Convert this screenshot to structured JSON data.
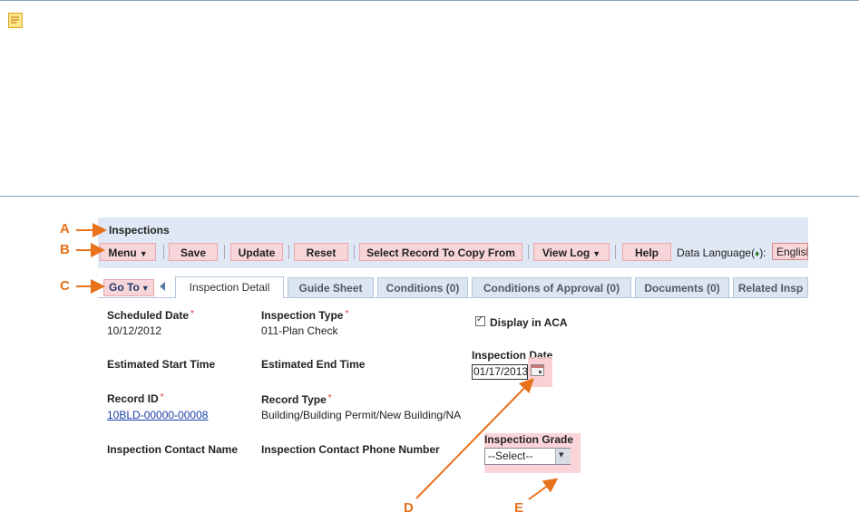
{
  "header": {
    "title": "Inspections"
  },
  "toolbar": {
    "menu_label": "Menu",
    "save_label": "Save",
    "update_label": "Update",
    "reset_label": "Reset",
    "copy_label": "Select Record To Copy From",
    "viewlog_label": "View Log",
    "help_label": "Help",
    "data_language_label": "Data Language(",
    "data_language_suffix": "):",
    "data_language_value": "English"
  },
  "goto": {
    "label": "Go To"
  },
  "tabs": [
    {
      "label": "Inspection Detail",
      "active": true
    },
    {
      "label": "Guide Sheet"
    },
    {
      "label": "Conditions (0)"
    },
    {
      "label": "Conditions of Approval (0)"
    },
    {
      "label": "Documents (0)"
    },
    {
      "label": "Related Insp"
    }
  ],
  "form": {
    "scheduled_date": {
      "label": "Scheduled Date",
      "value": "10/12/2012"
    },
    "inspection_type": {
      "label": "Inspection Type",
      "value": "011-Plan Check"
    },
    "display_aca": {
      "label": "Display in ACA",
      "checked": true
    },
    "est_start": {
      "label": "Estimated Start Time"
    },
    "est_end": {
      "label": "Estimated End Time"
    },
    "inspection_date": {
      "label": "Inspection Date",
      "value": "01/17/2013"
    },
    "record_id": {
      "label": "Record ID",
      "value": "10BLD-00000-00008"
    },
    "record_type": {
      "label": "Record Type",
      "value": "Building/Building Permit/New Building/NA"
    },
    "contact_name": {
      "label": "Inspection Contact Name"
    },
    "contact_phone": {
      "label": "Inspection Contact Phone Number"
    },
    "inspection_grade": {
      "label": "Inspection Grade",
      "value": "--Select--"
    },
    "required_mark": "*"
  },
  "callouts": {
    "a": "A",
    "b": "B",
    "c": "C",
    "d": "D",
    "e": "E"
  },
  "colors": {
    "callout": "#e8711c",
    "highlight": "#f9c9ce",
    "header_bg": "#dfe8f4"
  }
}
